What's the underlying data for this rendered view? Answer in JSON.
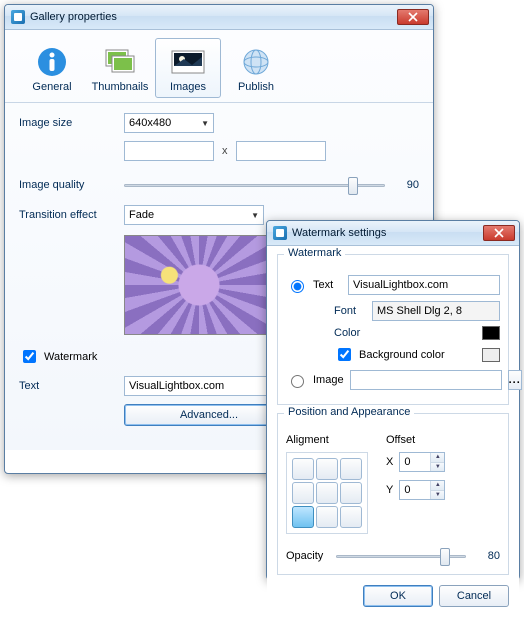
{
  "main": {
    "title": "Gallery properties",
    "tabs": {
      "general": "General",
      "thumbnails": "Thumbnails",
      "images": "Images",
      "publish": "Publish"
    },
    "labels": {
      "image_size": "Image size",
      "image_quality": "Image quality",
      "transition_effect": "Transition effect",
      "watermark": "Watermark",
      "text": "Text"
    },
    "image_size_value": "640x480",
    "image_width": "",
    "image_height": "",
    "dim_sep": "x",
    "image_quality": "90",
    "transition_value": "Fade",
    "watermark_checked": true,
    "text_value": "VisualLightbox.com",
    "advanced_label": "Advanced..."
  },
  "wm": {
    "title": "Watermark settings",
    "group_watermark": "Watermark",
    "opt_text": "Text",
    "text_value": "VisualLightbox.com",
    "font_label": "Font",
    "font_value": "MS Shell Dlg 2, 8",
    "color_label": "Color",
    "bgcolor_label": "Background color",
    "bgcolor_checked": true,
    "opt_image": "Image",
    "image_path": "",
    "browse_label": "...",
    "group_pa": "Position and Appearance",
    "alignment_label": "Aligment",
    "offset_label": "Offset",
    "x_label": "X",
    "y_label": "Y",
    "x_value": "0",
    "y_value": "0",
    "opacity_label": "Opacity",
    "opacity_value": "80",
    "ok_label": "OK",
    "cancel_label": "Cancel"
  }
}
